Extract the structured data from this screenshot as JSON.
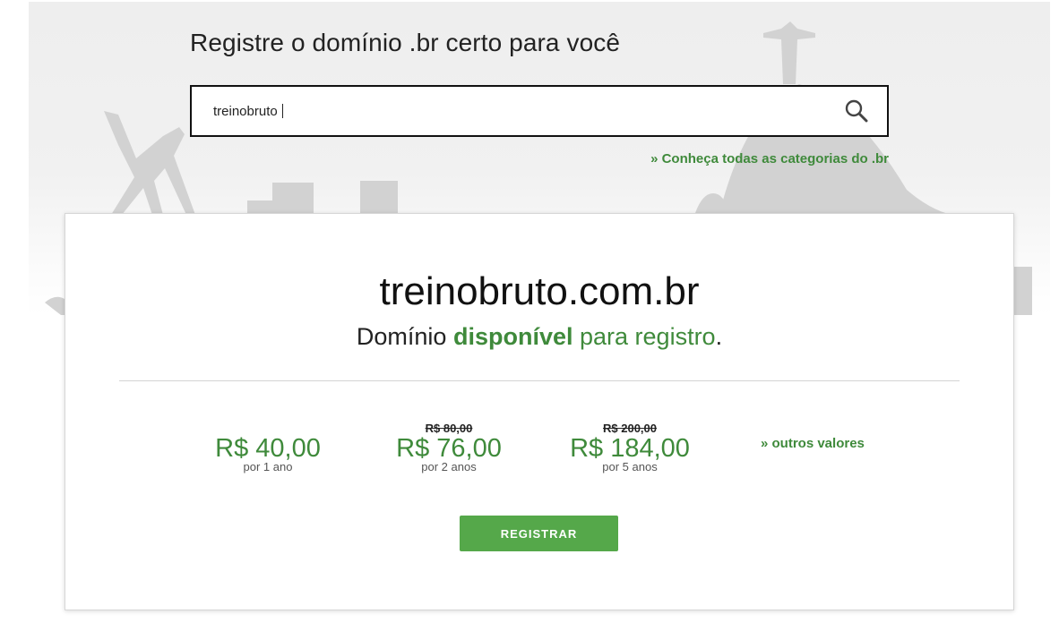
{
  "header": {
    "title": "Registre o domínio .br certo para você"
  },
  "search": {
    "value": "treinobruto",
    "icon": "search-icon"
  },
  "categories_link": "» Conheça todas as categorias do .br",
  "result": {
    "domain": "treinobruto.com.br",
    "status_prefix": "Domínio",
    "status_word": "disponível",
    "status_suffix": "para registro",
    "status_end": "."
  },
  "prices": [
    {
      "old": "",
      "value": "R$ 40,00",
      "period": "por 1 ano"
    },
    {
      "old": "R$ 80,00",
      "value": "R$ 76,00",
      "period": "por 2 anos"
    },
    {
      "old": "R$ 200,00",
      "value": "R$ 184,00",
      "period": "por 5 anos"
    }
  ],
  "other_values_link": "» outros valores",
  "register_button": "REGISTRAR",
  "colors": {
    "accent_green": "#3f8a3b",
    "button_green": "#55a84a"
  }
}
